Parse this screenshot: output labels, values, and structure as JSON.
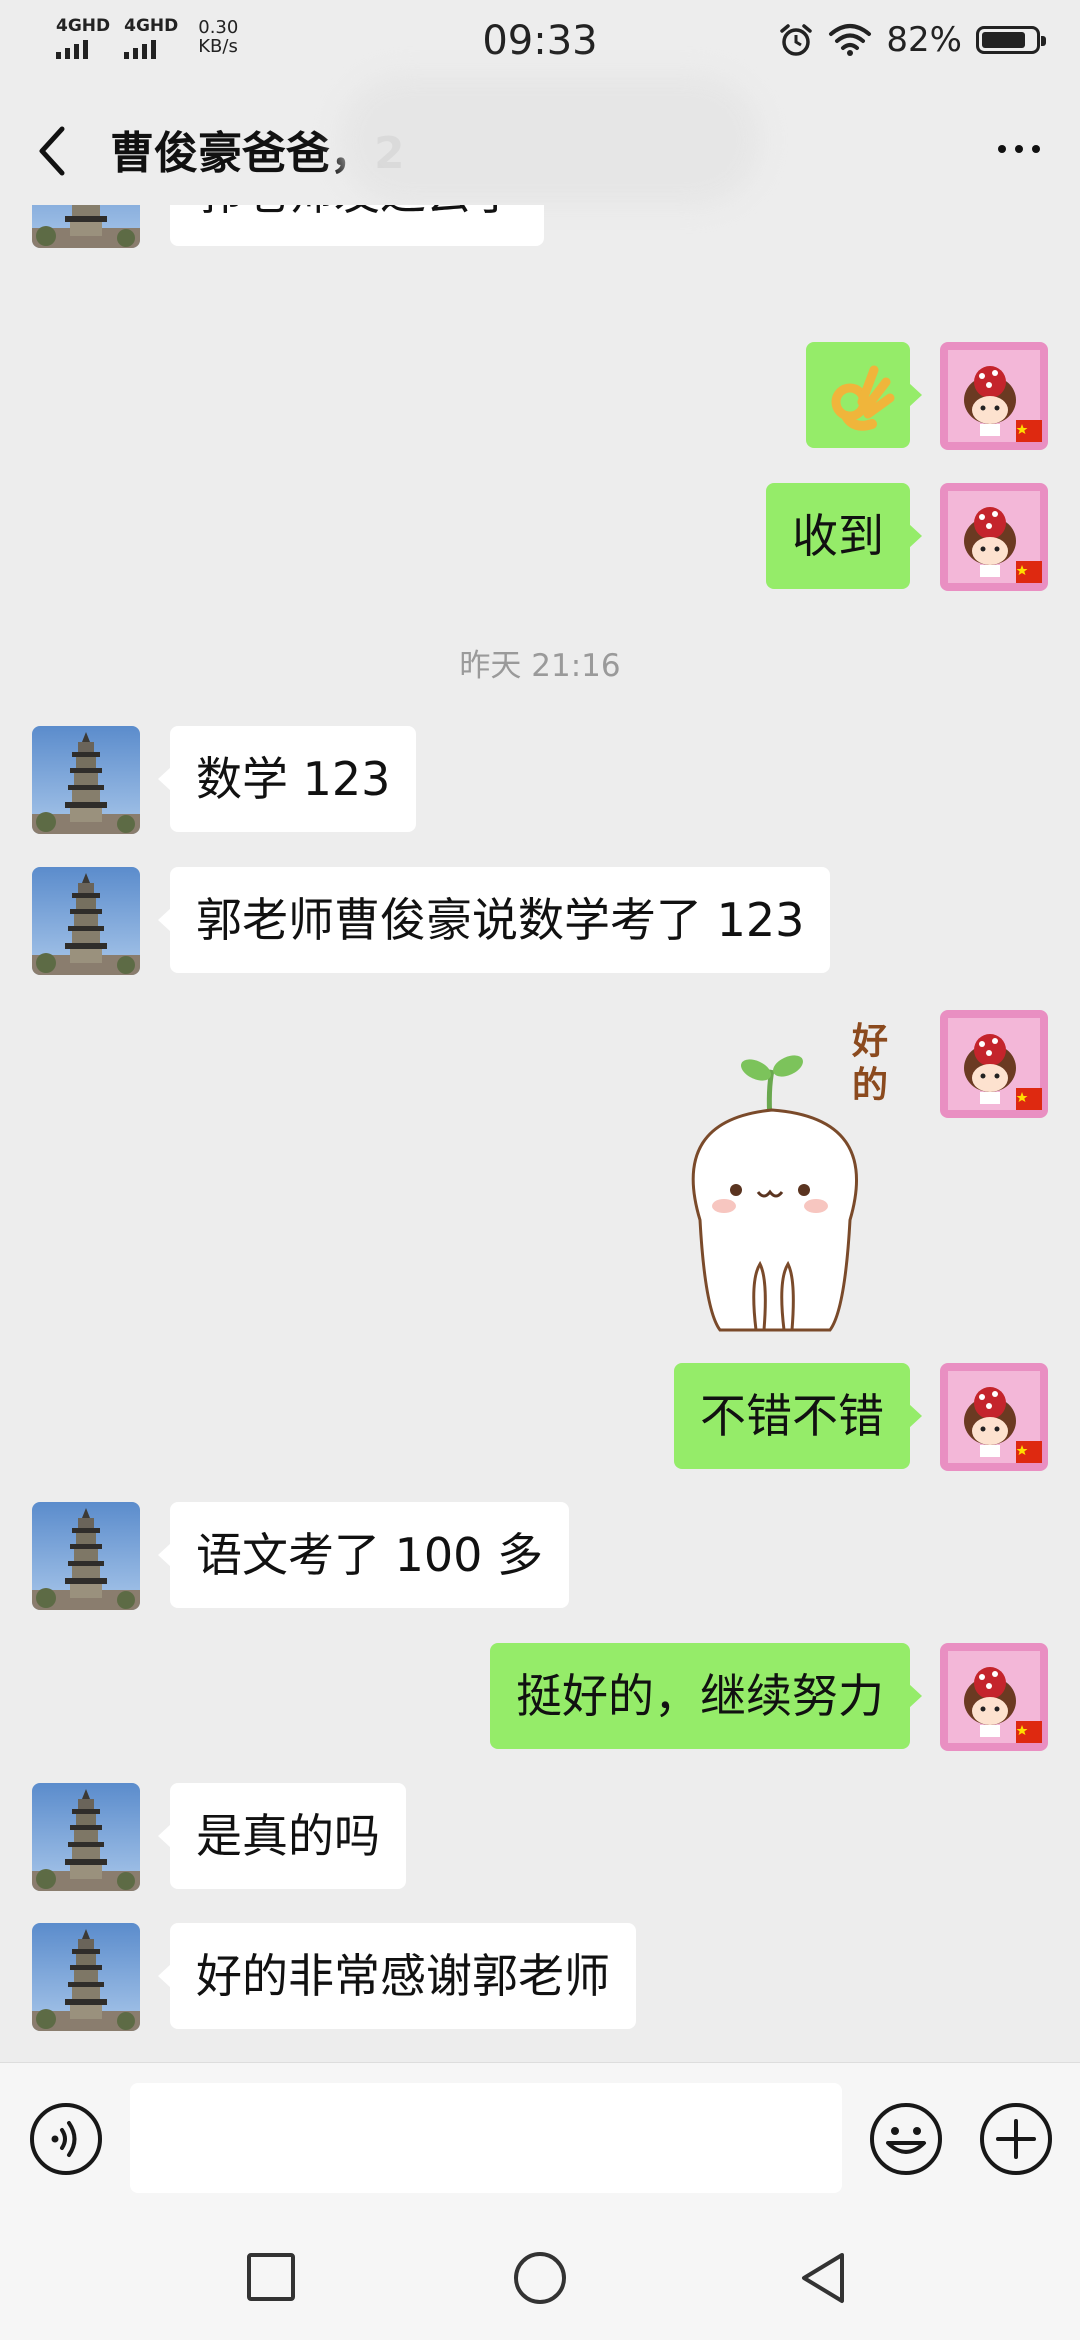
{
  "status_bar": {
    "network_1": "4GHD",
    "network_2": "4GHD",
    "speed_value": "0.30",
    "speed_unit": "KB/s",
    "time": "09:33",
    "battery_percent": "82%",
    "battery_level": 0.82
  },
  "header": {
    "title": "曹俊豪爸爸，2"
  },
  "chat": {
    "timestamp": "昨天 21:16",
    "messages": [
      {
        "side": "left",
        "text": "郭老师发过去了"
      },
      {
        "side": "right",
        "type": "emoji",
        "icon": "ok-hand-emoji"
      },
      {
        "side": "right",
        "text": "收到"
      },
      {
        "side": "left",
        "text": "数学 123"
      },
      {
        "side": "left",
        "text": "郭老师曹俊豪说数学考了 123"
      },
      {
        "side": "right",
        "type": "sticker",
        "sticker_text": "好的"
      },
      {
        "side": "right",
        "text": "不错不错"
      },
      {
        "side": "left",
        "text": "语文考了 100 多"
      },
      {
        "side": "right",
        "text": "挺好的，继续努力"
      },
      {
        "side": "left",
        "text": "是真的吗"
      },
      {
        "side": "left",
        "text": "好的非常感谢郭老师"
      }
    ]
  },
  "input_bar": {
    "voice_icon": "voice-icon",
    "emoji_icon": "emoji-icon",
    "plus_icon": "plus-icon"
  },
  "nav_bar": {
    "recent_icon": "square-icon",
    "home_icon": "circle-icon",
    "back_icon": "triangle-back-icon"
  },
  "colors": {
    "background": "#ededed",
    "self_bubble": "#95ec69",
    "other_bubble": "#ffffff",
    "timestamp": "#9a9a9a"
  }
}
